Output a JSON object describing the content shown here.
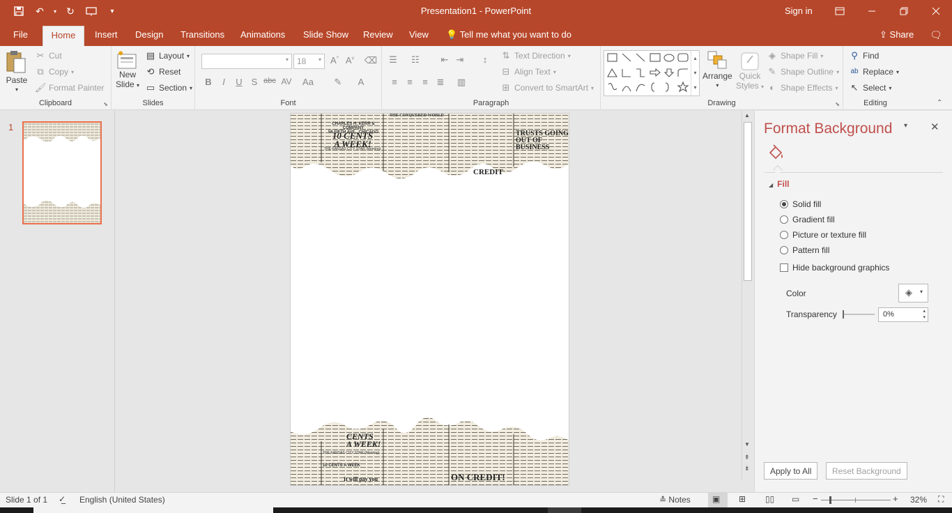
{
  "titlebar": {
    "title": "Presentation1 - PowerPoint",
    "sign_in": "Sign in",
    "bg_color": "#b7472a"
  },
  "tabs": [
    {
      "label": "File"
    },
    {
      "label": "Home"
    },
    {
      "label": "Insert"
    },
    {
      "label": "Design"
    },
    {
      "label": "Transitions"
    },
    {
      "label": "Animations"
    },
    {
      "label": "Slide Show"
    },
    {
      "label": "Review"
    },
    {
      "label": "View"
    }
  ],
  "tell_me": "Tell me what you want to do",
  "share": "Share",
  "ribbon": {
    "clipboard": {
      "paste": "Paste",
      "cut": "Cut",
      "copy": "Copy",
      "format_painter": "Format Painter",
      "label": "Clipboard"
    },
    "slides": {
      "new_slide_1": "New",
      "new_slide_2": "Slide",
      "layout": "Layout",
      "reset": "Reset",
      "section": "Section",
      "label": "Slides"
    },
    "font": {
      "font_size": "18",
      "label": "Font"
    },
    "paragraph": {
      "text_direction": "Text Direction",
      "align_text": "Align Text",
      "convert_smartart": "Convert to SmartArt",
      "label": "Paragraph"
    },
    "drawing": {
      "arrange": "Arrange",
      "quick_styles_1": "Quick",
      "quick_styles_2": "Styles",
      "shape_fill": "Shape Fill",
      "shape_outline": "Shape Outline",
      "shape_effects": "Shape Effects",
      "label": "Drawing"
    },
    "editing": {
      "find": "Find",
      "replace": "Replace",
      "select": "Select",
      "label": "Editing"
    }
  },
  "thumbnails": [
    {
      "number": "1"
    }
  ],
  "format_background": {
    "title": "Format Background",
    "section": "Fill",
    "options": [
      {
        "label": "Solid fill",
        "selected": true
      },
      {
        "label": "Gradient fill",
        "selected": false
      },
      {
        "label": "Picture or texture fill",
        "selected": false
      },
      {
        "label": "Pattern fill",
        "selected": false
      }
    ],
    "hide_graphics": "Hide background graphics",
    "color_label": "Color",
    "transparency_label": "Transparency",
    "transparency_value": "0%",
    "apply_all": "Apply to All",
    "reset_bg": "Reset Background"
  },
  "slide_news": {
    "top": [
      "TRUSTS GOING",
      "OUT OF BUSINESS",
      "10 CENTS",
      "A WEEK!",
      "CHARLES H. KERR & COMPANY",
      "56 FIFTH AVE., CHICAGO",
      "THE KANSAS CITY STAR (Morning)",
      "THE CONQUERED WORLD",
      "CREDIT"
    ],
    "bottom": [
      "ON CREDIT!",
      "It will pay you",
      "CENTS",
      "A WEEK!",
      "THE KANSAS CITY STAR (Morning)",
      "10 CENTS A WEEK"
    ]
  },
  "status": {
    "slide_info": "Slide 1 of 1",
    "language": "English (United States)",
    "notes": "Notes",
    "zoom": "32%"
  }
}
